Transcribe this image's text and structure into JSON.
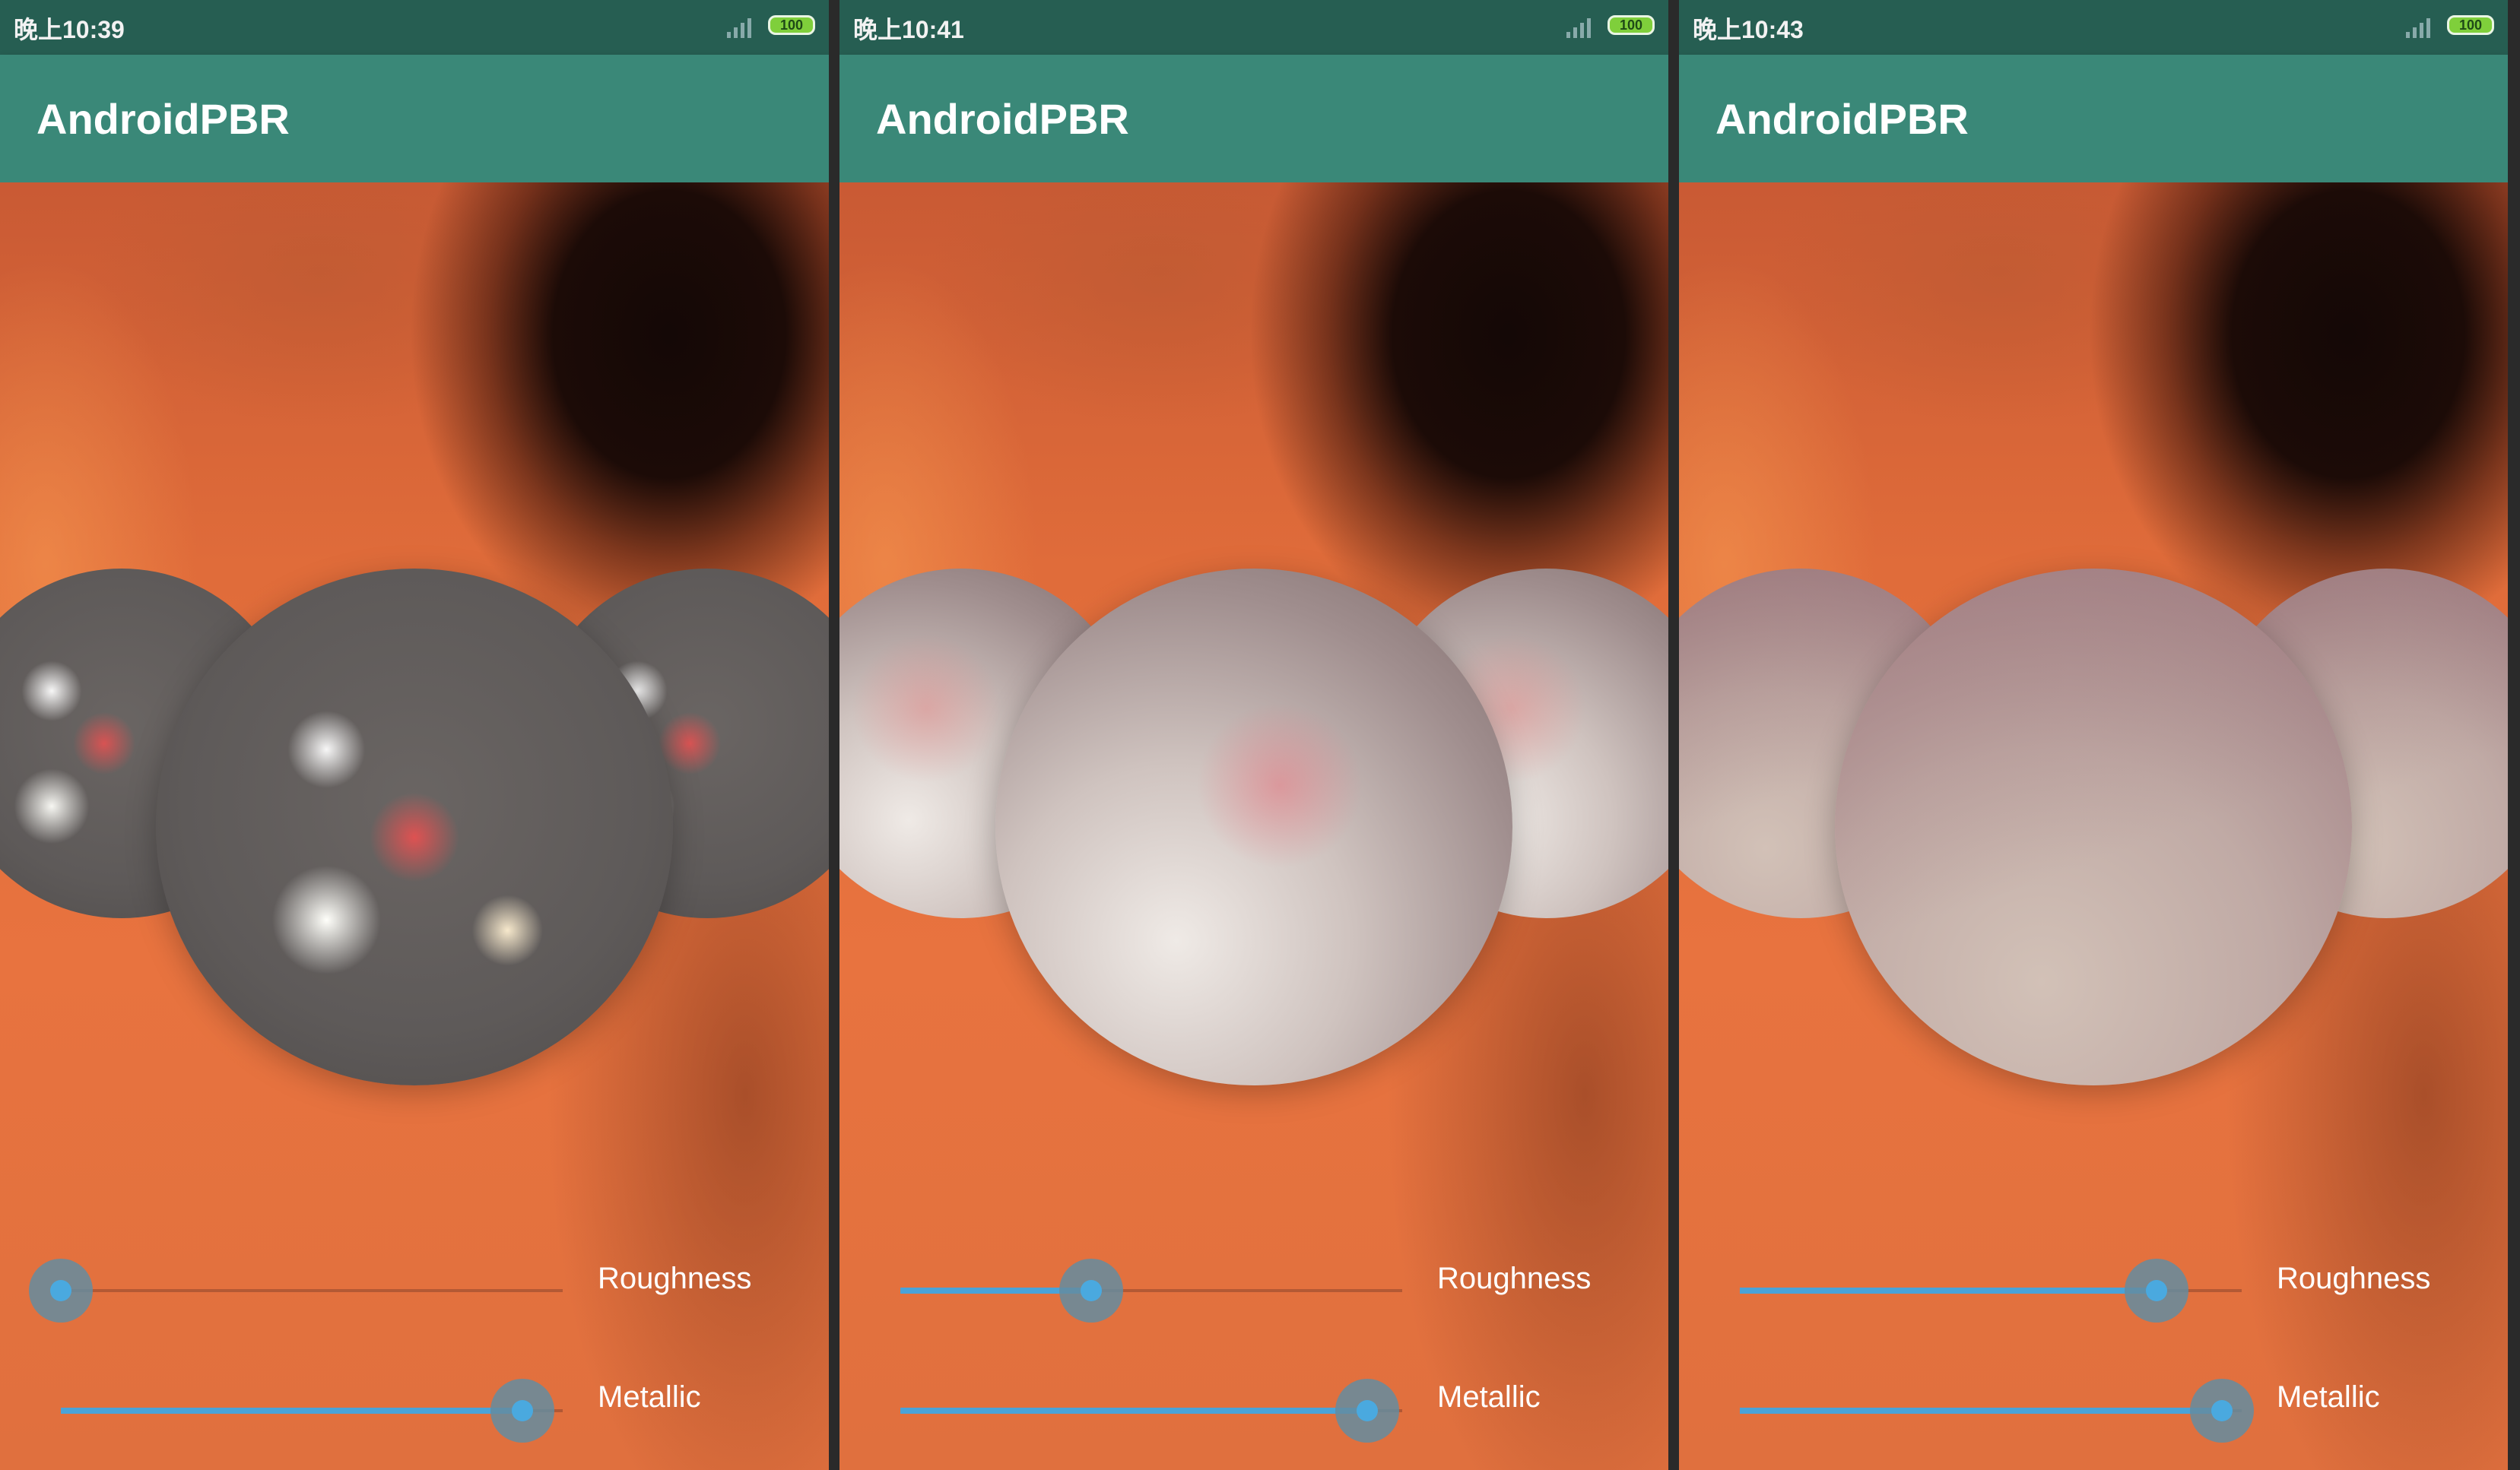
{
  "app_title": "AndroidPBR",
  "screens": [
    {
      "time": "晚上10:39",
      "battery": "100",
      "roughness_label": "Roughness",
      "metallic_label": "Metallic",
      "roughness": 0.0,
      "metallic": 0.92,
      "material": "metal-glossy"
    },
    {
      "time": "晚上10:41",
      "battery": "100",
      "roughness_label": "Roughness",
      "metallic_label": "Metallic",
      "roughness": 0.38,
      "metallic": 0.93,
      "material": "metal-rough"
    },
    {
      "time": "晚上10:43",
      "battery": "100",
      "roughness_label": "Roughness",
      "metallic_label": "Metallic",
      "roughness": 0.83,
      "metallic": 0.96,
      "material": "matte"
    }
  ],
  "colors": {
    "status_bar": "#265e52",
    "app_bar": "#3a8878",
    "slider_accent": "#4aa9df"
  },
  "icons": [
    "signal-icon",
    "battery-icon"
  ]
}
